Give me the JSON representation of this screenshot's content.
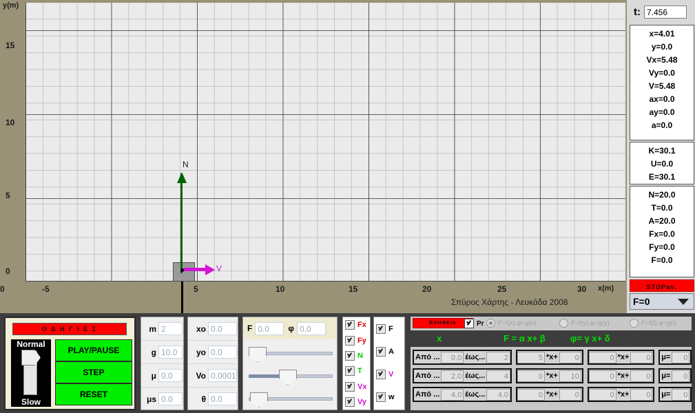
{
  "graph": {
    "y_axis_title": "y(m)",
    "x_axis_title": "x(m)",
    "y_ticks": [
      "15",
      "10",
      "5",
      "0"
    ],
    "x_ticks": [
      "-5",
      "0",
      "5",
      "10",
      "15",
      "20",
      "25",
      "30"
    ],
    "credit": "Σπύρος Χάρτης - Λευκάδα 2008",
    "vectors": {
      "normal_label": "N",
      "velocity_label": "V"
    },
    "colors": {
      "normal": "#006400",
      "velocity": "#d215d2",
      "weight": "#000000",
      "background": "#9a9277",
      "plot_bg": "#ebebeb"
    }
  },
  "readout": {
    "time_label": "t:",
    "time_value": "7.456",
    "kinematics": [
      "x=4.01",
      "y=0.0",
      "Vx=5.48",
      "Vy=0.0",
      "V=5.48",
      "ax=0.0",
      "ay=0.0",
      "a=0.0"
    ],
    "energy": [
      "K=30.1",
      "U=0.0",
      "E=30.1"
    ],
    "forces": [
      "N=20.0",
      "T=0.0",
      "A=20.0",
      "Fx=0.0",
      "Fy=0.0",
      "F=0.0"
    ],
    "stop_label": "STOP",
    "stop_sub": "αν.",
    "force_select_value": "F=0"
  },
  "controls": {
    "help_label": "Ο Δ Η Γ Ι Ε Σ",
    "speed_top": "Normal",
    "speed_bottom": "Slow",
    "buttons": [
      "PLAY/PAUSE",
      "STEP",
      "RESET"
    ]
  },
  "params_left": [
    {
      "label": "m",
      "value": "2"
    },
    {
      "label": "g",
      "value": "10.0"
    },
    {
      "label": "μ",
      "value": "0.0"
    },
    {
      "label": "μs",
      "value": "0.0"
    }
  ],
  "params_right": [
    {
      "label": "xo",
      "value": "0.0"
    },
    {
      "label": "yo",
      "value": "0.0"
    },
    {
      "label": "Vo",
      "value": "0.0001"
    },
    {
      "label": "θ",
      "value": "0.0"
    }
  ],
  "force_sliders": {
    "F_label": "F",
    "F_value": "0.0",
    "phi_label": "φ",
    "phi_value": "0.0",
    "positions": [
      0,
      40,
      2
    ]
  },
  "checkboxes_col1": [
    {
      "label": "Fx",
      "color": "#e00000",
      "checked": true
    },
    {
      "label": "Fy",
      "color": "#e00000",
      "checked": true
    },
    {
      "label": "N",
      "color": "#00cc00",
      "checked": true
    },
    {
      "label": "T",
      "color": "#00cc00",
      "checked": true
    },
    {
      "label": "Vx",
      "color": "#d215d2",
      "checked": true
    },
    {
      "label": "Vy",
      "color": "#d215d2",
      "checked": true
    }
  ],
  "checkboxes_col2": [
    {
      "label": "F",
      "color": "#000000",
      "checked": true
    },
    {
      "label": "A",
      "color": "#000000",
      "checked": true
    },
    {
      "label": "V",
      "color": "#d215d2",
      "checked": true
    },
    {
      "label": "w",
      "color": "#000000",
      "checked": true
    }
  ],
  "formula_panel": {
    "help_label": "ΒΟΗΘΕΙΑ",
    "pr_label": "Pr",
    "radios": [
      {
        "label": "F=f(x),φ=g(x)",
        "selected": true
      },
      {
        "label": "F=f(y),φ=g(y)",
        "selected": false
      },
      {
        "label": "F=f(t),φ=g(t)",
        "selected": false
      }
    ],
    "header_x": "x",
    "header_F": "F =  α  x+ β",
    "header_phi": "φ=  γ  x+ δ",
    "from_label": "Από ...",
    "to_label": "έως...",
    "mult_label": "*x+",
    "mu_label": "μ=",
    "rows": [
      {
        "from": "0.0",
        "to": "2",
        "alpha": "5",
        "beta": "0",
        "gamma": "0",
        "delta": "0",
        "mu": "0"
      },
      {
        "from": "2.0",
        "to": "4",
        "alpha": "0",
        "beta": "10",
        "gamma": "0",
        "delta": "0",
        "mu": "0"
      },
      {
        "from": "4.0",
        "to": "4.0",
        "alpha": "0",
        "beta": "0",
        "gamma": "0",
        "delta": "0",
        "mu": "0"
      }
    ]
  }
}
